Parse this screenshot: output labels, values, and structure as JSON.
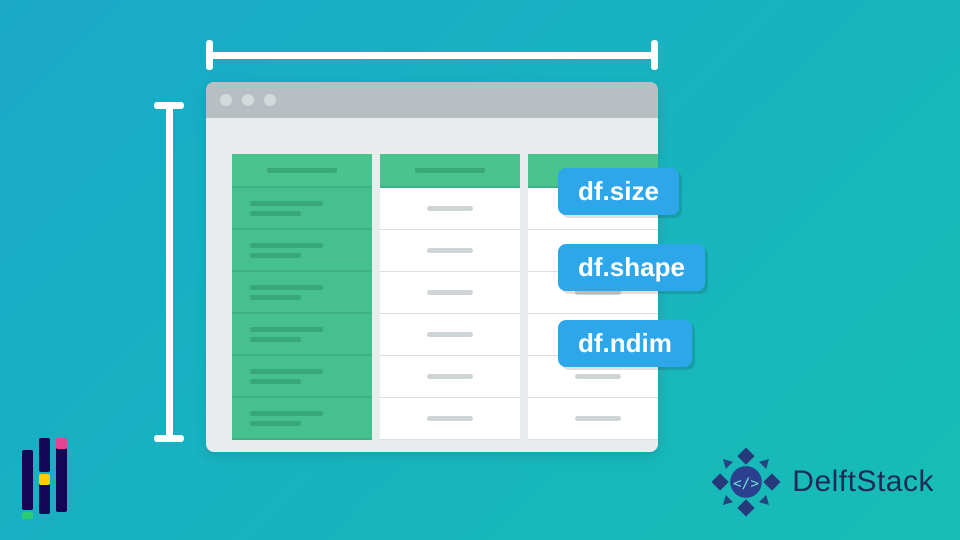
{
  "labels": {
    "size": "df.size",
    "shape": "df.shape",
    "ndim": "df.ndim"
  },
  "brand": {
    "name": "DelftStack"
  },
  "diagram": {
    "subject": "pandas DataFrame dimension attributes",
    "window_dots": 3,
    "table": {
      "header_cols": 3,
      "body_rows": 6
    },
    "rulers": {
      "horizontal": true,
      "vertical": true
    }
  },
  "colors": {
    "bg_from": "#1aa9c9",
    "bg_to": "#16bdb5",
    "label_bg": "#2ea7ea",
    "table_green": "#49c490",
    "brand_text": "#1f2a56"
  }
}
